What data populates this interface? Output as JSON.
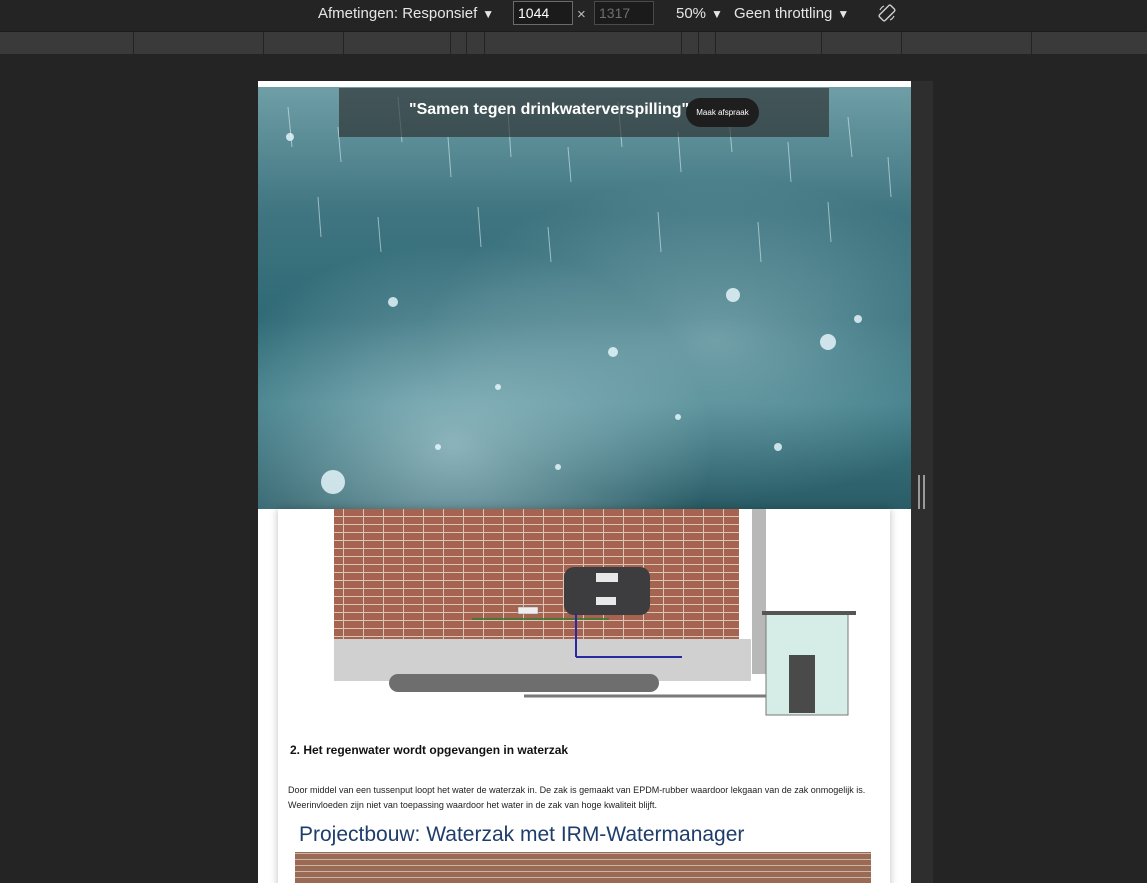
{
  "toolbar": {
    "dimensions_label": "Afmetingen: Responsief",
    "width_value": "1044",
    "height_value": "1317",
    "times_symbol": "×",
    "zoom_label": "50%",
    "throttling_label": "Geen throttling",
    "caret": "▼",
    "rotate_icon": "rotate-icon"
  },
  "page": {
    "header": {
      "tagline": "\"Samen tegen drinkwaterverspilling\"",
      "cta_label": "Maak afspraak"
    },
    "step": {
      "heading": "2. Het regenwater wordt opgevangen in waterzak",
      "text": "Door middel van een tussenput loopt het water de waterzak in. De zak is gemaakt van EPDM-rubber waardoor lekgaan van de zak onmogelijk is. Weerinvloeden zijn niet van toepassing waardoor het water in de zak van hoge kwaliteit blijft."
    },
    "slide": {
      "title": "Projectbouw: Waterzak met IRM-Watermanager"
    }
  },
  "colors": {
    "devtools_bg": "#242424",
    "ruler": "#3a3a3a",
    "slide_title": "#1f3d6b"
  }
}
